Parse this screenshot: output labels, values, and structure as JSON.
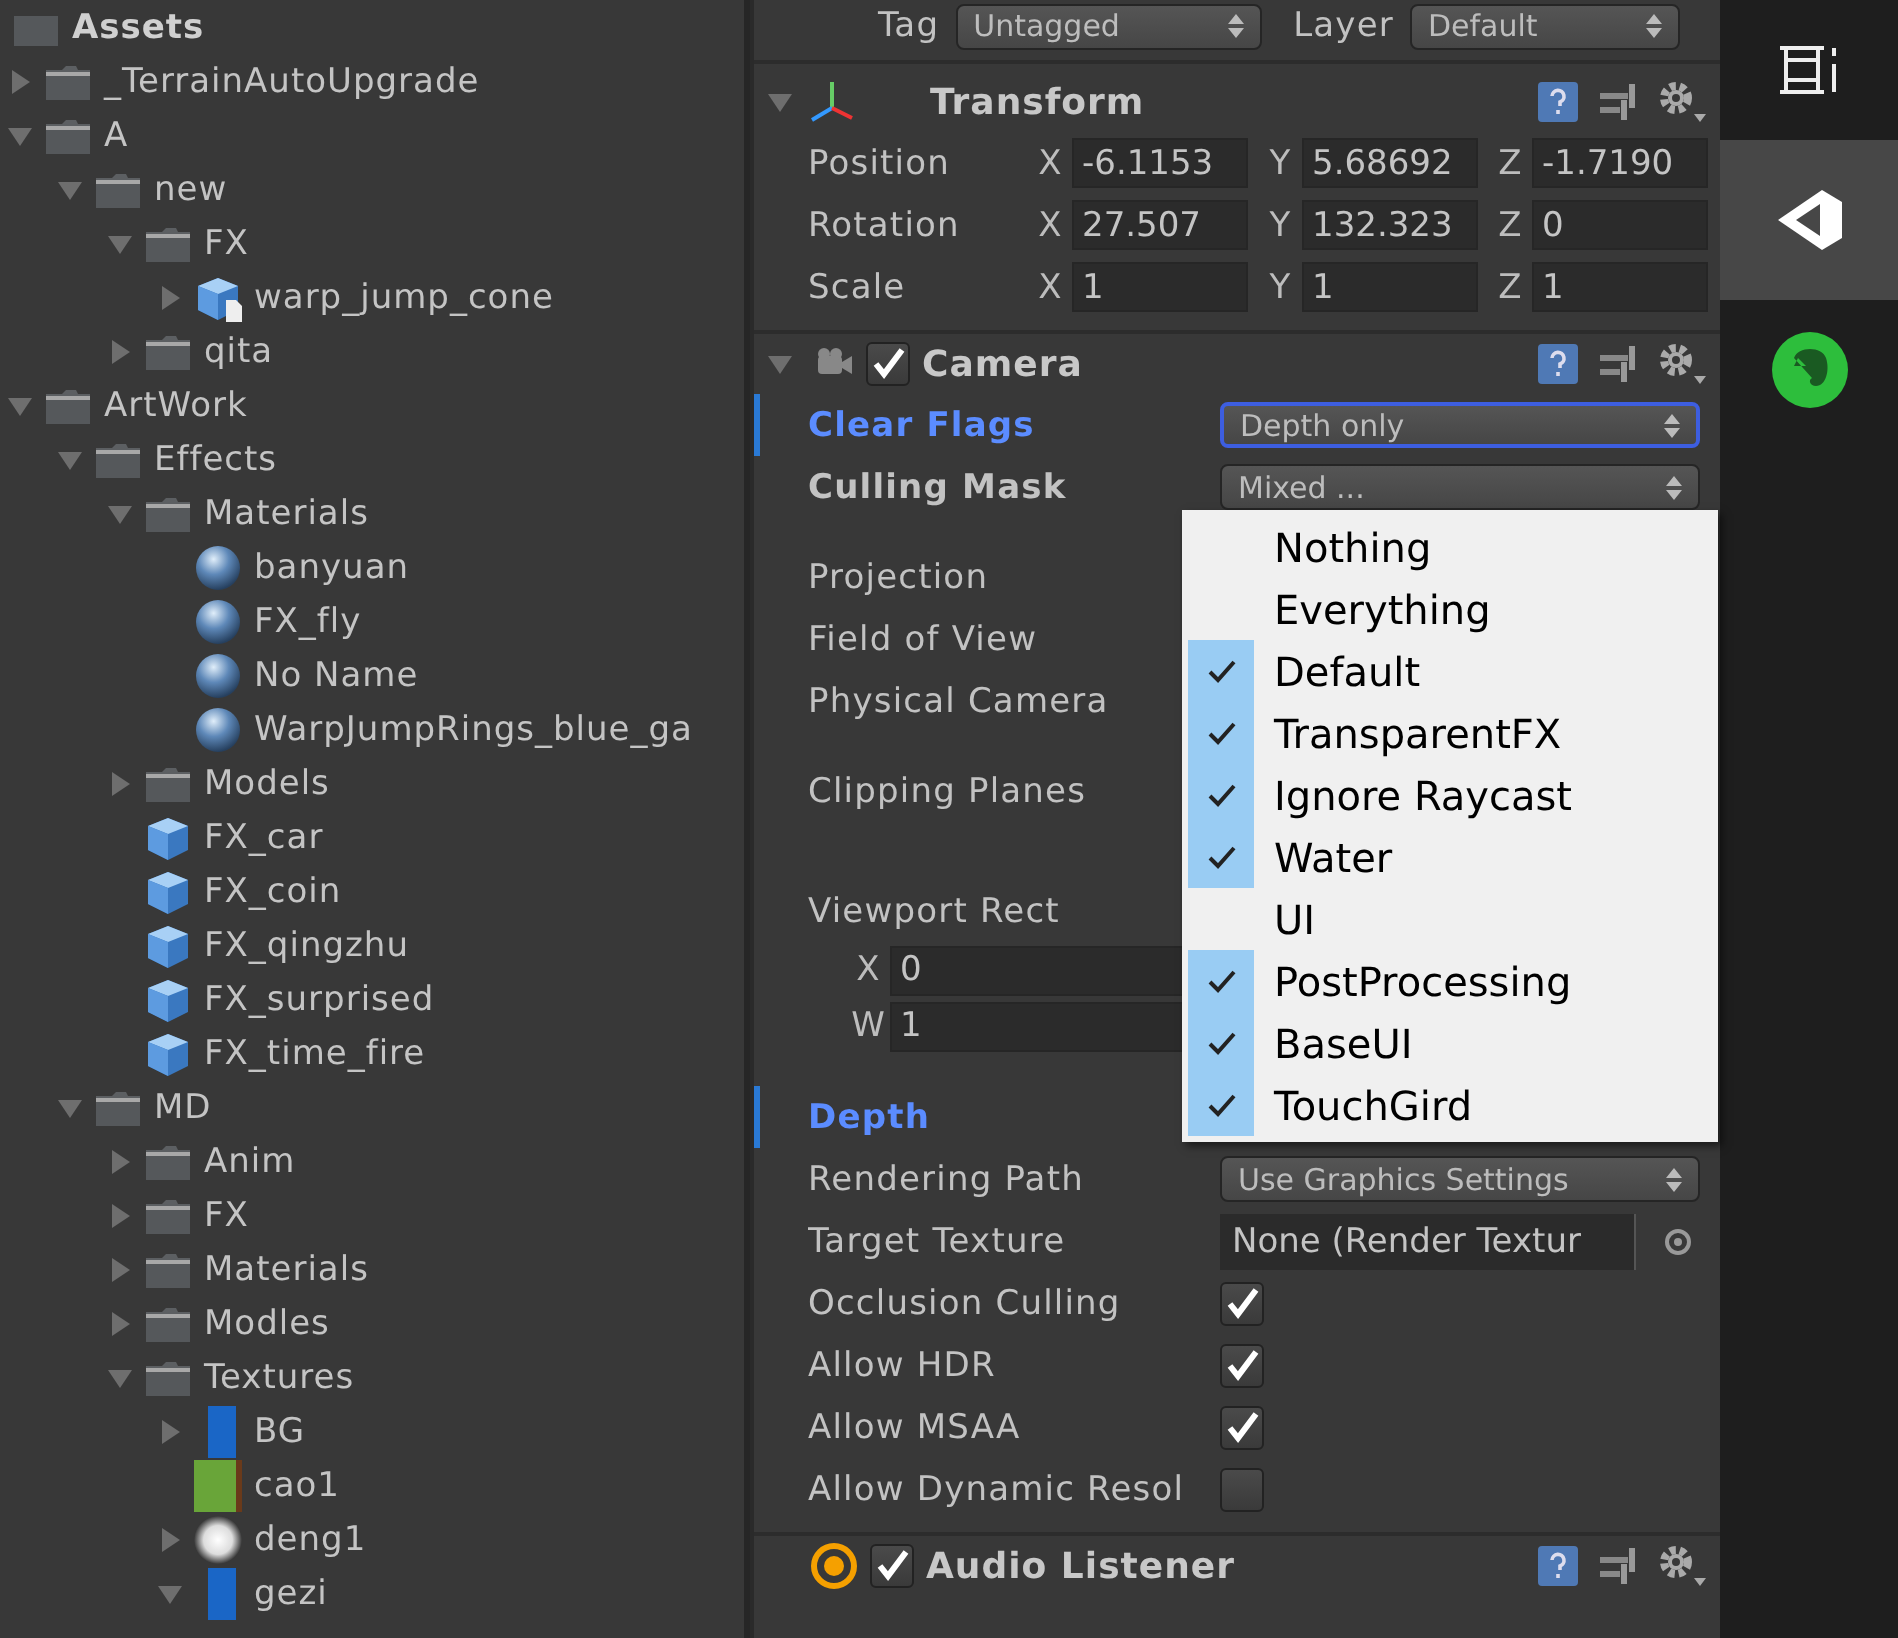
{
  "project": {
    "root": "Assets",
    "items": [
      {
        "name": "_TerrainAutoUpgrade",
        "kind": "folder",
        "expanded": false
      },
      {
        "name": "A",
        "kind": "folder",
        "expanded": true,
        "children": [
          {
            "name": "new",
            "kind": "folder",
            "expanded": true,
            "children": [
              {
                "name": "FX",
                "kind": "folder",
                "expanded": true,
                "children": [
                  {
                    "name": "warp_jump_cone",
                    "kind": "model",
                    "expanded": false
                  }
                ]
              },
              {
                "name": "qita",
                "kind": "folder",
                "expanded": false
              }
            ]
          }
        ]
      },
      {
        "name": "ArtWork",
        "kind": "folder",
        "expanded": true,
        "children": [
          {
            "name": "Effects",
            "kind": "folder",
            "expanded": true,
            "children": [
              {
                "name": "Materials",
                "kind": "folder",
                "expanded": true,
                "children": [
                  {
                    "name": "banyuan",
                    "kind": "material"
                  },
                  {
                    "name": "FX_fly",
                    "kind": "material"
                  },
                  {
                    "name": "No Name",
                    "kind": "material"
                  },
                  {
                    "name": "WarpJumpRings_blue_ga",
                    "kind": "material"
                  }
                ]
              },
              {
                "name": "Models",
                "kind": "folder",
                "expanded": false
              },
              {
                "name": "FX_car",
                "kind": "prefab"
              },
              {
                "name": "FX_coin",
                "kind": "prefab"
              },
              {
                "name": "FX_qingzhu",
                "kind": "prefab"
              },
              {
                "name": "FX_surprised",
                "kind": "prefab"
              },
              {
                "name": "FX_time_fire",
                "kind": "prefab"
              }
            ]
          },
          {
            "name": "MD",
            "kind": "folder",
            "expanded": true,
            "children": [
              {
                "name": "Anim",
                "kind": "folder",
                "expanded": false
              },
              {
                "name": "FX",
                "kind": "folder",
                "expanded": false
              },
              {
                "name": "Materials",
                "kind": "folder",
                "expanded": false
              },
              {
                "name": "Modles",
                "kind": "folder",
                "expanded": false
              },
              {
                "name": "Textures",
                "kind": "folder",
                "expanded": true,
                "children": [
                  {
                    "name": "BG",
                    "kind": "strip",
                    "expanded": false
                  },
                  {
                    "name": "cao1",
                    "kind": "swatch"
                  },
                  {
                    "name": "deng1",
                    "kind": "glow",
                    "expanded": false
                  },
                  {
                    "name": "gezi",
                    "kind": "strip",
                    "expanded": true
                  }
                ]
              }
            ]
          }
        ]
      }
    ]
  },
  "inspector": {
    "tag_label": "Tag",
    "tag": "Untagged",
    "layer_label": "Layer",
    "layer": "Default",
    "transform": {
      "title": "Transform",
      "rows": [
        {
          "label": "Position",
          "fields": [
            {
              "axis": "X",
              "value": "-6.1153"
            },
            {
              "axis": "Y",
              "value": "5.68692"
            },
            {
              "axis": "Z",
              "value": "-1.7190"
            }
          ]
        },
        {
          "label": "Rotation",
          "fields": [
            {
              "axis": "X",
              "value": "27.507"
            },
            {
              "axis": "Y",
              "value": "132.323"
            },
            {
              "axis": "Z",
              "value": "0"
            }
          ]
        },
        {
          "label": "Scale",
          "fields": [
            {
              "axis": "X",
              "value": "1"
            },
            {
              "axis": "Y",
              "value": "1"
            },
            {
              "axis": "Z",
              "value": "1"
            }
          ]
        }
      ]
    },
    "camera": {
      "title": "Camera",
      "enabled": true,
      "properties": [
        {
          "kind": "popup",
          "label": "Clear Flags",
          "value": "Depth only",
          "bold": true,
          "highlighted": true
        },
        {
          "kind": "mask",
          "label": "Culling Mask",
          "value": "Mixed ...",
          "bold": true,
          "highlighted": false
        },
        {
          "kind": "label",
          "label": "Projection",
          "bold": false,
          "highlighted": false
        },
        {
          "kind": "label",
          "label": "Field of View",
          "bold": false,
          "highlighted": false
        },
        {
          "kind": "label",
          "label": "Physical Camera",
          "bold": false,
          "highlighted": false
        },
        {
          "kind": "planes",
          "label": "Clipping Planes",
          "bold": false,
          "highlighted": false
        },
        {
          "kind": "rect",
          "label": "Viewport Rect",
          "bold": false,
          "highlighted": false,
          "fields": [
            {
              "axis": "X",
              "value": "0"
            },
            {
              "axis": "W",
              "value": "1"
            }
          ]
        },
        {
          "kind": "label",
          "label": "Depth",
          "bold": true,
          "highlighted": true
        },
        {
          "kind": "popup",
          "label": "Rendering Path",
          "value": "Use Graphics Settings",
          "bold": false,
          "highlighted": false
        },
        {
          "kind": "object",
          "label": "Target Texture",
          "value": "None (Render Textur",
          "bold": false,
          "highlighted": false
        },
        {
          "kind": "checkbox",
          "label": "Occlusion Culling",
          "checked": true,
          "bold": false,
          "highlighted": false
        },
        {
          "kind": "checkbox",
          "label": "Allow HDR",
          "checked": true,
          "bold": false,
          "highlighted": false
        },
        {
          "kind": "checkbox",
          "label": "Allow MSAA",
          "checked": true,
          "bold": false,
          "highlighted": false
        },
        {
          "kind": "checkbox",
          "label": "Allow Dynamic Resol",
          "checked": false,
          "bold": false,
          "highlighted": false
        }
      ]
    },
    "audio_listener": {
      "title": "Audio Listener",
      "enabled": true
    },
    "layer_menu": [
      {
        "label": "Nothing",
        "checked": false
      },
      {
        "label": "Everything",
        "checked": false
      },
      {
        "label": "Default",
        "checked": true
      },
      {
        "label": "TransparentFX",
        "checked": true
      },
      {
        "label": "Ignore Raycast",
        "checked": true
      },
      {
        "label": "Water",
        "checked": true
      },
      {
        "label": "UI",
        "checked": false
      },
      {
        "label": "PostProcessing",
        "checked": true
      },
      {
        "label": "BaseUI",
        "checked": true
      },
      {
        "label": "TouchGird",
        "checked": true
      }
    ]
  },
  "side_tabs": [
    {
      "kind": "layout",
      "selected": false
    },
    {
      "kind": "logo",
      "selected": true
    },
    {
      "kind": "elephant",
      "selected": false
    }
  ]
}
